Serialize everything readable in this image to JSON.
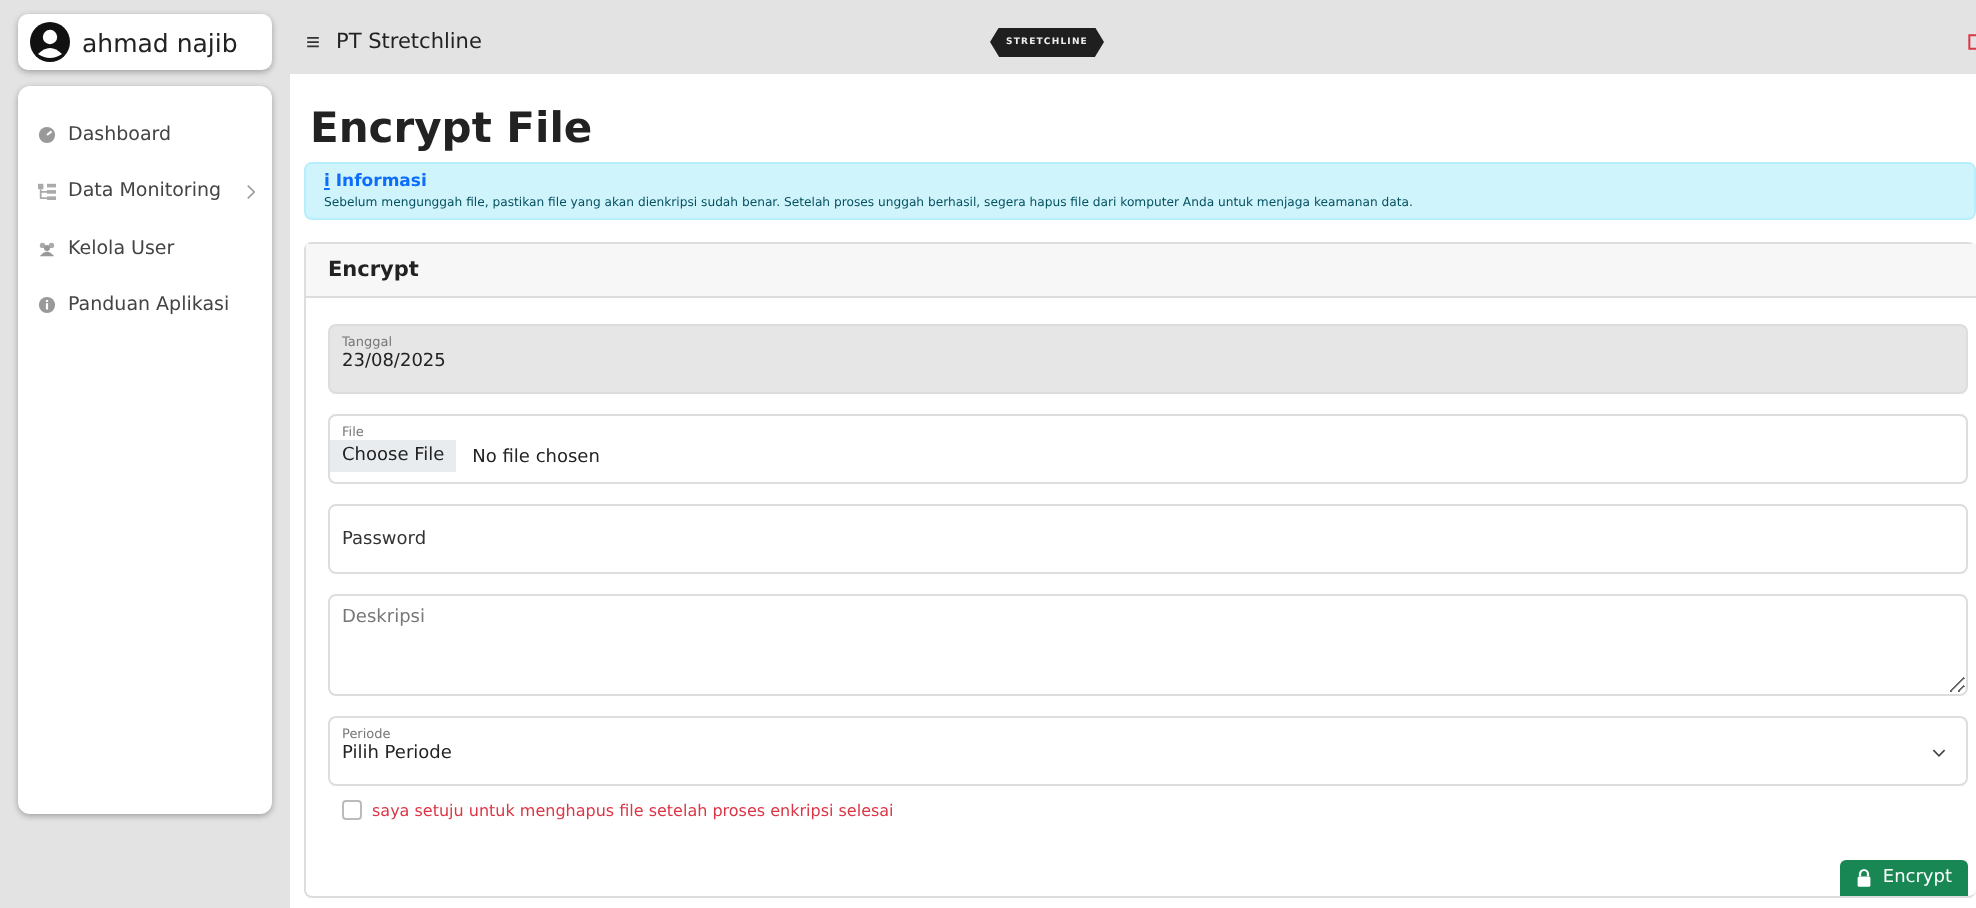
{
  "user": {
    "name": "ahmad najib"
  },
  "header": {
    "menu_glyph": "≡",
    "company": "PT Stretchline",
    "logo": "STRETCHLINE"
  },
  "sidebar": {
    "items": [
      {
        "label": "Dashboard",
        "expandable": false
      },
      {
        "label": "Data Monitoring",
        "expandable": true
      },
      {
        "label": "Kelola User",
        "expandable": false
      },
      {
        "label": "Panduan Aplikasi",
        "expandable": false
      }
    ]
  },
  "page": {
    "title": "Encrypt File"
  },
  "alert": {
    "icon": "i",
    "title": "Informasi",
    "text": "Sebelum mengunggah file, pastikan file yang akan dienkripsi sudah benar. Setelah proses unggah berhasil, segera hapus file dari komputer Anda untuk menjaga keamanan data."
  },
  "form": {
    "title": "Encrypt",
    "fields": [
      {
        "kind": "date",
        "label": "Tanggal",
        "value": "23/08/2025",
        "disabled": true
      },
      {
        "kind": "file",
        "label": "File",
        "button": "Choose File",
        "value": "No file chosen"
      },
      {
        "kind": "text",
        "placeholder": "Password"
      },
      {
        "kind": "textarea",
        "placeholder": "Deskripsi"
      },
      {
        "kind": "select",
        "label": "Periode",
        "value": "Pilih Periode"
      }
    ],
    "consent": {
      "label": "saya setuju untuk menghapus file setelah proses enkripsi selesai",
      "checked": false
    },
    "submit": "Encrypt"
  }
}
